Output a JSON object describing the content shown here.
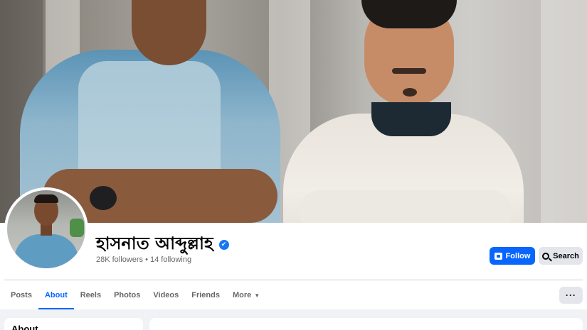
{
  "profile": {
    "name": "হাসনাত আব্দুল্লাহ",
    "stats": "28K followers • 14 following",
    "verified_mark": "✔"
  },
  "actions": {
    "follow_label": "Follow",
    "search_label": "Search",
    "more_label": "···"
  },
  "tabs": [
    {
      "label": "Posts",
      "active": false
    },
    {
      "label": "About",
      "active": true
    },
    {
      "label": "Reels",
      "active": false
    },
    {
      "label": "Photos",
      "active": false
    },
    {
      "label": "Videos",
      "active": false
    },
    {
      "label": "Friends",
      "active": false
    },
    {
      "label": "More",
      "active": false
    }
  ],
  "content": {
    "about_title": "About"
  },
  "colors": {
    "accent": "#0866ff",
    "secondary_button": "#e4e6eb",
    "text_muted": "#65676b",
    "background": "#f0f2f5"
  },
  "icons": {
    "follow": "follow-page-icon",
    "search": "search-icon",
    "verified": "verified-badge-icon",
    "more_caret": "caret-down-icon"
  }
}
